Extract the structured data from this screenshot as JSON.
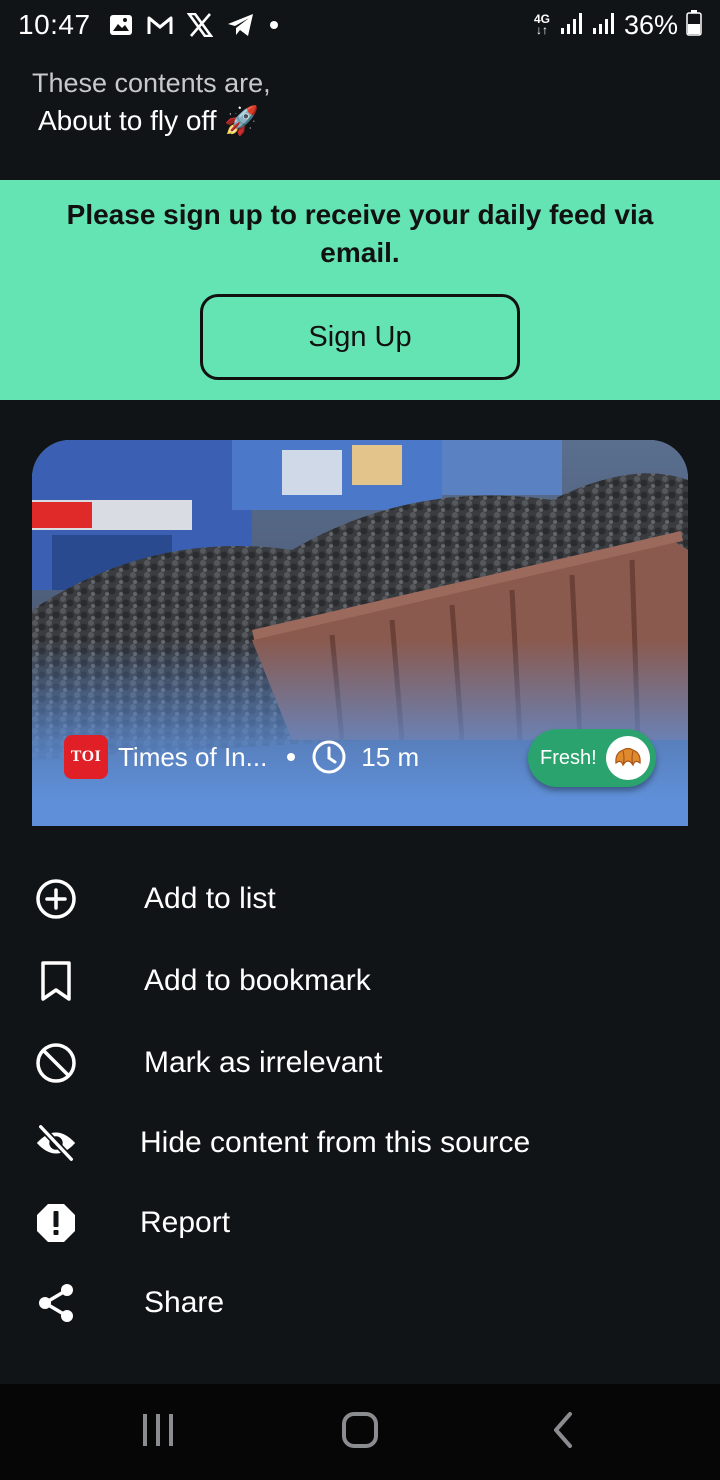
{
  "status_bar": {
    "time": "10:47",
    "network": "4G",
    "battery": "36%",
    "icons": [
      "gallery-icon",
      "gmail-icon",
      "x-icon",
      "telegram-icon",
      "dot-icon"
    ]
  },
  "header": {
    "line1": "These contents are,",
    "line2": "About to fly off 🚀"
  },
  "signup": {
    "message": "Please sign up to receive your daily feed via email.",
    "button_label": "Sign Up",
    "background": "#64e3b3"
  },
  "card": {
    "source_logo": "TOI",
    "source_name": "Times of In...",
    "age": "15 m",
    "badge": "Fresh!",
    "image_subject": "coal-train-wagons"
  },
  "menu": {
    "items": [
      {
        "label": "Add to list",
        "icon": "add-circle-icon"
      },
      {
        "label": "Add to bookmark",
        "icon": "bookmark-icon"
      },
      {
        "label": "Mark as irrelevant",
        "icon": "block-icon"
      },
      {
        "label": "Hide content from this source",
        "icon": "eye-off-icon"
      },
      {
        "label": "Report",
        "icon": "report-icon"
      },
      {
        "label": "Share",
        "icon": "share-icon"
      }
    ]
  },
  "nav_bar": {
    "buttons": [
      "recent-apps-icon",
      "home-icon",
      "back-icon"
    ]
  }
}
